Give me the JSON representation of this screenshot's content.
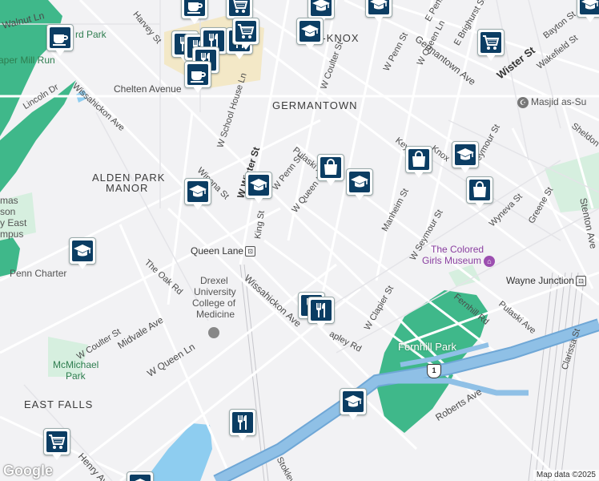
{
  "map": {
    "colors": {
      "background": "#f2f2f4",
      "park": "#3fb88a",
      "water": "#8ecdf0",
      "highway": "#8fc0e6",
      "highway_edge": "#6fa7d6",
      "campus": "#f3e8c7",
      "pin": "#0b3d63"
    },
    "area_labels": {
      "germantown": "GERMANTOWN",
      "penn_knox": "N-KNOX",
      "alden_park": "ALDEN PARK",
      "manor": "MANOR",
      "east_falls": "EAST FALLS"
    },
    "street_labels": {
      "walnut": "Walnut Ln",
      "paper_mill": "aper Mill Run",
      "lincoln": "Lincoln Dr",
      "wissahickon1": "Wissahickon Ave",
      "wissahickon2": "Wissahickon Ave",
      "chelten": "Chelten Avenue",
      "school_house": "W School House Ln",
      "winona": "Winona St",
      "w_wister": "W Wister St",
      "king": "King St",
      "w_penn": "W Penn St",
      "w_penn2": "W Penn St",
      "w_queen": "W Queen Ln",
      "w_queen2": "W Queen Ln",
      "w_queen3": "W Queen Ln",
      "pulaski": "Pulaski Ave",
      "pulaski2": "Pulaski Ave",
      "w_coulter": "W Coulter St",
      "w_coulter2": "W Coulter St",
      "germantown_ave": "Germantown Ave",
      "wister": "Wister St",
      "e_penn": "E Penn St",
      "e_brighurst": "E Brighurst St",
      "bayton": "Bayton St",
      "wakefield": "Wakefield St",
      "sheldon": "Sheldon",
      "keyser": "Keyser",
      "knox": "Knox",
      "seymour": "Seymour St",
      "w_seymour": "W Seymour St",
      "manheim": "Manheim St",
      "wyneva": "Wyneva St",
      "greene": "Greene St",
      "the_oak": "The Oak Rd",
      "midvale": "Midvale Ave",
      "w_clapier": "W Clapier St",
      "fernhill_rd": "Fernhill Rd",
      "roberts": "Roberts Ave",
      "clarissa": "Clarissa St",
      "henry": "Henry Ave",
      "stokley": "Stokley St",
      "apley": "apley Rd",
      "harvey": "Harvey St",
      "stenton": "Stenton Ave"
    },
    "poi_labels": {
      "vernon_park": "rd Park",
      "queen_lane": "Queen Lane",
      "drexel1": "Drexel",
      "drexel2": "University",
      "drexel3": "College of",
      "drexel4": "Medicine",
      "penn_charter": "Penn Charter",
      "mcmichael1": "McMichael",
      "mcmichael2": "Park",
      "fernhill_park": "Fernhill Park",
      "colored_girls1": "The Colored",
      "colored_girls2": "Girls Museum",
      "wayne_junction": "Wayne Junction",
      "masjid": "Masjid as-Su",
      "left_campus1": "mas",
      "left_campus2": "son",
      "left_campus3": "y East",
      "left_campus4": "mpus"
    },
    "route_shield": "1",
    "footer": {
      "logo": "Google",
      "attribution": "Map data ©2025"
    },
    "pins": [
      {
        "type": "coffee",
        "name": "coffee-pin"
      },
      {
        "type": "grocery",
        "name": "grocery-pin"
      },
      {
        "type": "school",
        "name": "school-pin"
      },
      {
        "type": "restaurant",
        "name": "restaurant-pin"
      },
      {
        "type": "shopping",
        "name": "shopping-pin"
      }
    ]
  }
}
